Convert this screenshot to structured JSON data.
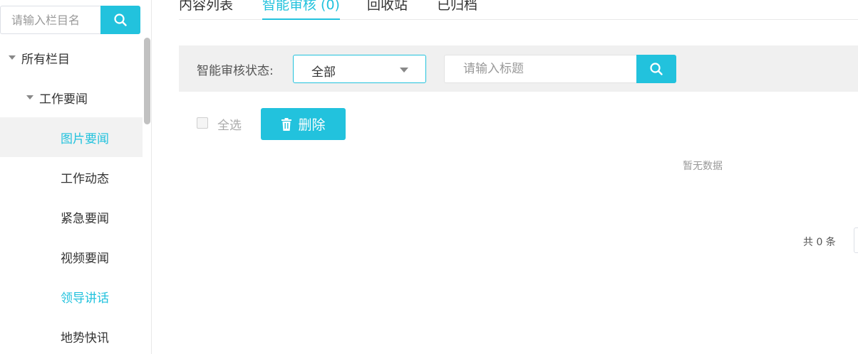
{
  "sidebar": {
    "search": {
      "placeholder": "请输入栏目名"
    },
    "tree": [
      {
        "label": "所有栏目",
        "level": 0,
        "expanded": true
      },
      {
        "label": "工作要闻",
        "level": 1,
        "expanded": true
      },
      {
        "label": "图片要闻",
        "level": 2,
        "selected": true
      },
      {
        "label": "工作动态",
        "level": 2
      },
      {
        "label": "紧急要闻",
        "level": 2
      },
      {
        "label": "视频要闻",
        "level": 2
      },
      {
        "label": "领导讲话",
        "level": 2,
        "highlighted": true
      },
      {
        "label": "地势快讯",
        "level": 2
      }
    ]
  },
  "tabs": [
    {
      "label": "内容列表"
    },
    {
      "label": "智能审核 (0)",
      "active": true
    },
    {
      "label": "回收站"
    },
    {
      "label": "已归档"
    }
  ],
  "filter": {
    "status_label": "智能审核状态:",
    "status_value": "全部",
    "title_placeholder": "请输入标题"
  },
  "actions": {
    "select_all": "全选",
    "delete": "删除"
  },
  "table": {
    "empty_text": "暂无数据"
  },
  "pagination": {
    "total_text": "共 0 条"
  },
  "colors": {
    "accent": "#22c2dd",
    "filter_bg": "#f0f0f0",
    "selected_bg": "#f2f2f2"
  },
  "icons": {
    "search": "search-icon",
    "delete": "trash-icon",
    "caret": "caret-down-icon"
  }
}
